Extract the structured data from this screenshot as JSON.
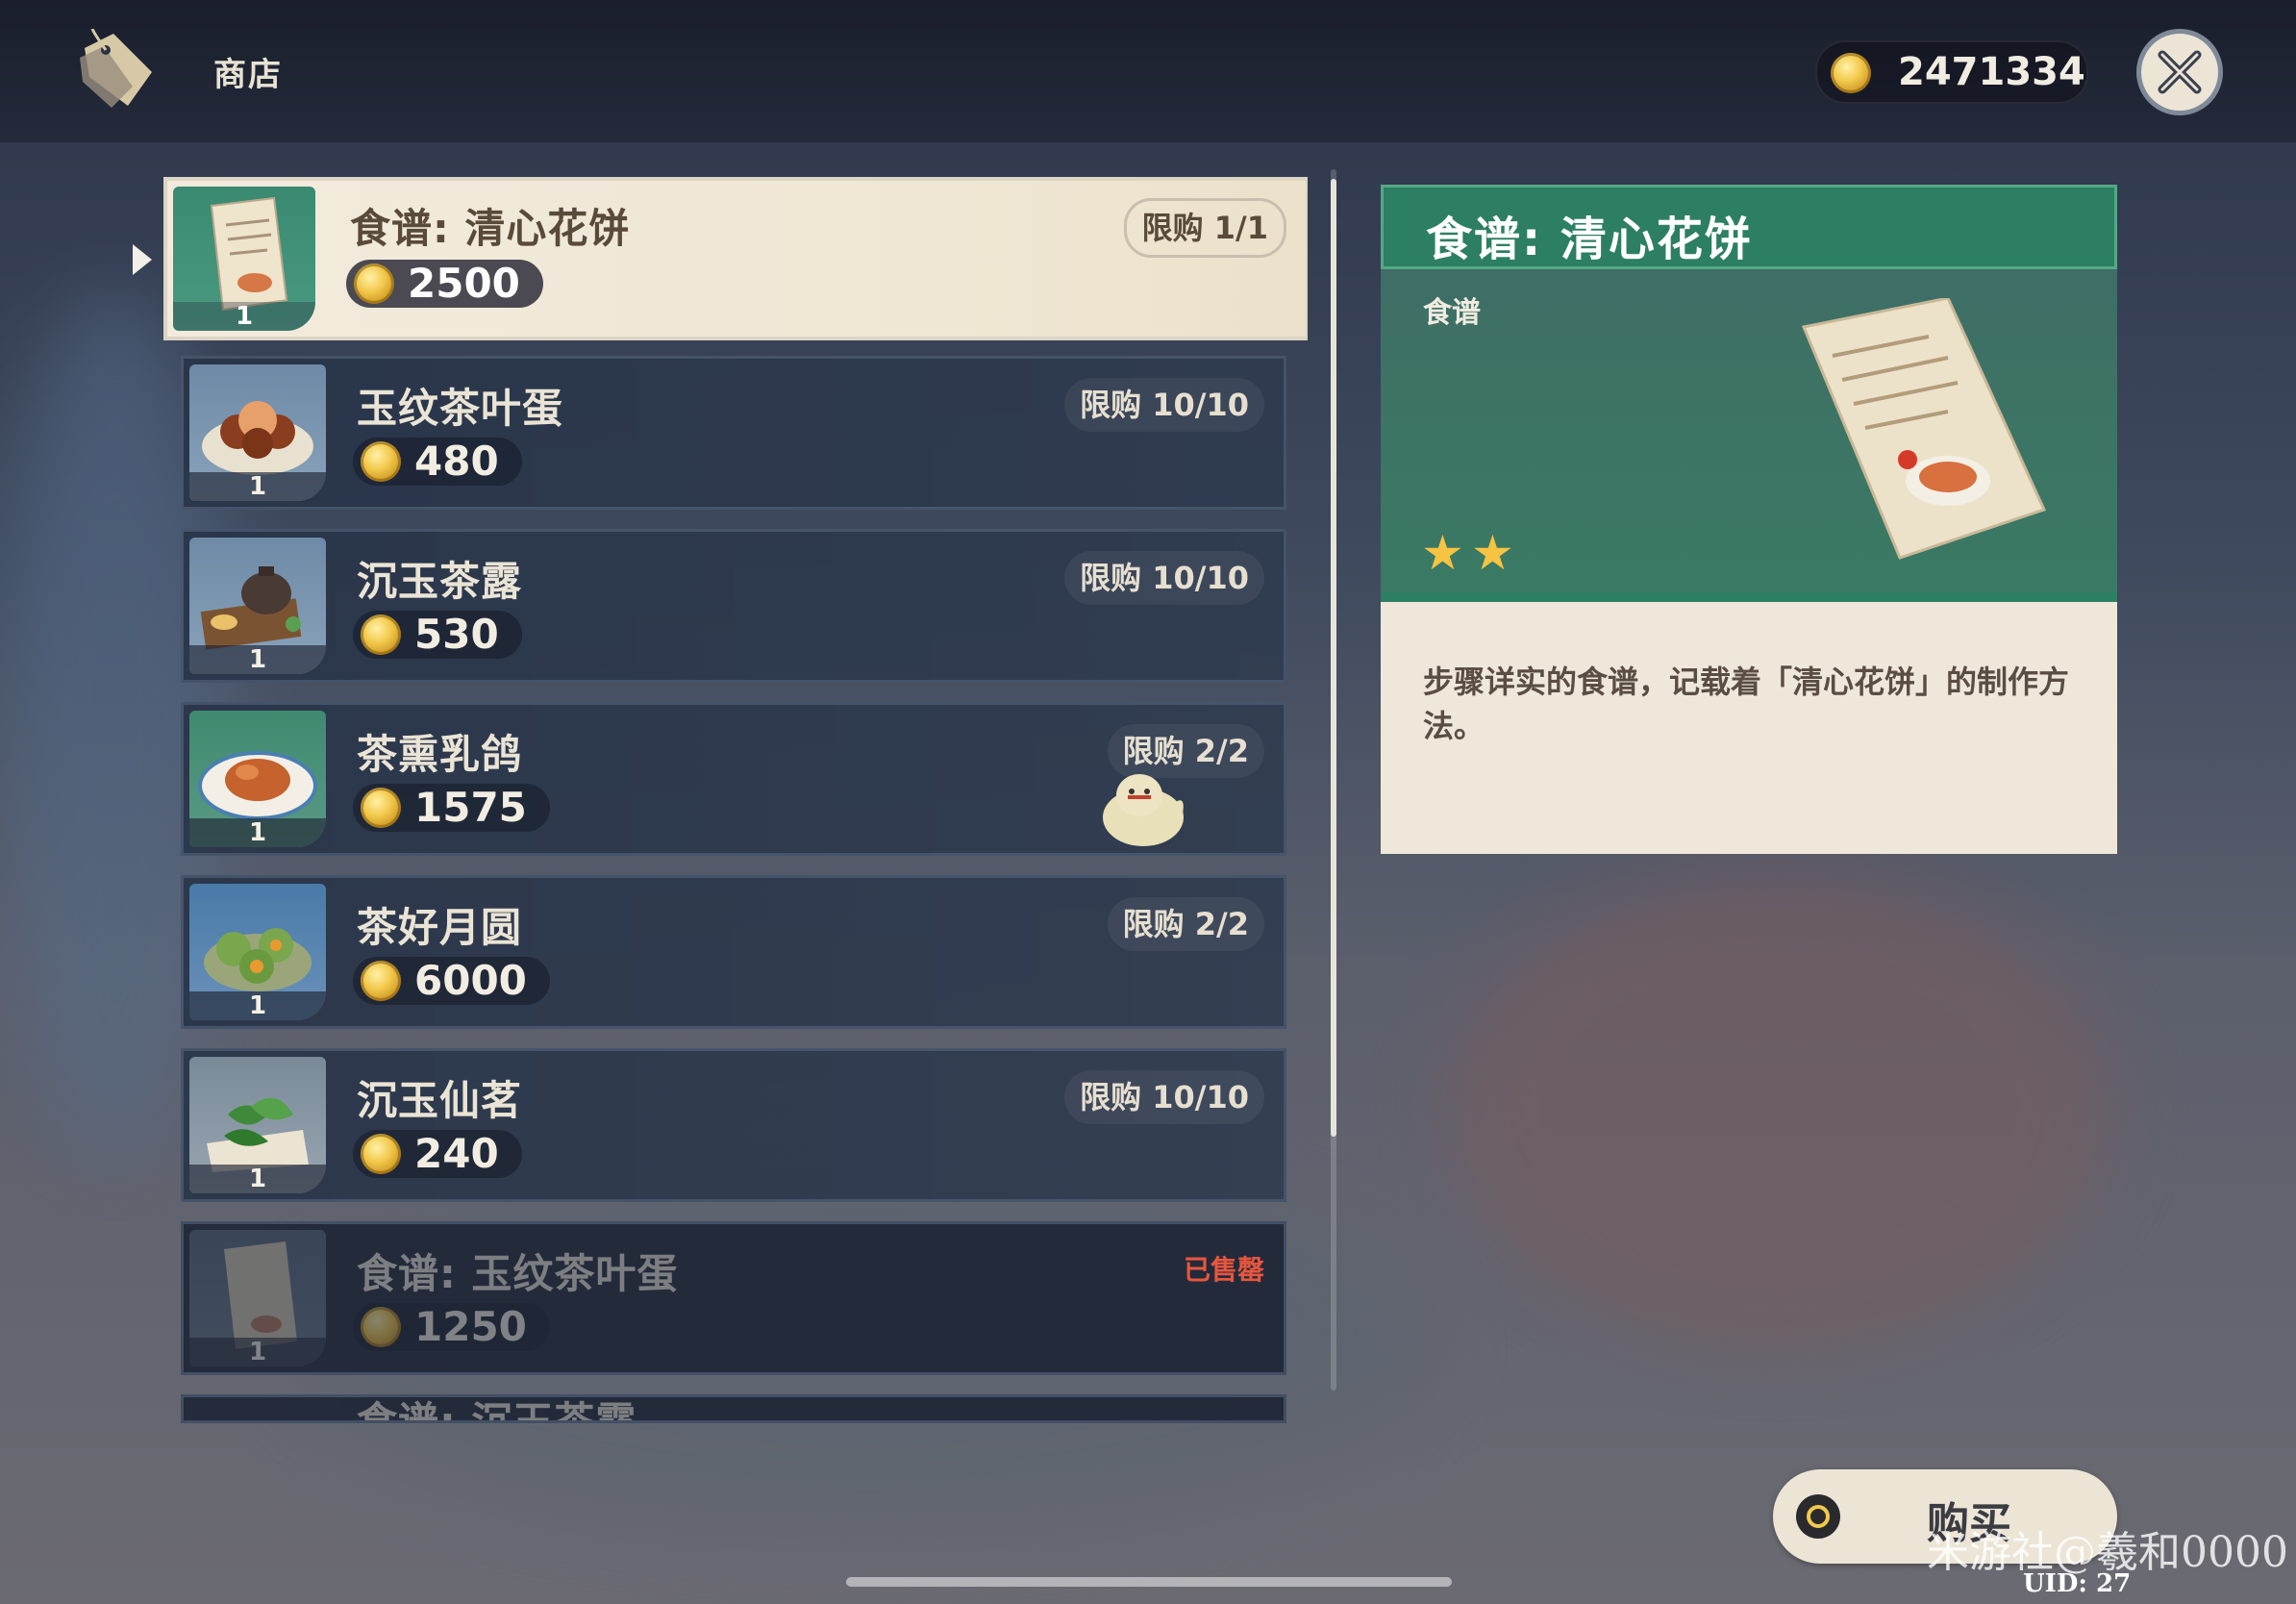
{
  "header": {
    "title": "商店",
    "currency": "2471334"
  },
  "items": [
    {
      "name": "食谱: 清心花饼",
      "price": "2500",
      "limit": "限购 1/1",
      "qty": "1"
    },
    {
      "name": "玉纹茶叶蛋",
      "price": "480",
      "limit": "限购 10/10",
      "qty": "1"
    },
    {
      "name": "沉玉茶露",
      "price": "530",
      "limit": "限购 10/10",
      "qty": "1"
    },
    {
      "name": "茶熏乳鸽",
      "price": "1575",
      "limit": "限购 2/2",
      "qty": "1"
    },
    {
      "name": "茶好月圆",
      "price": "6000",
      "limit": "限购 2/2",
      "qty": "1"
    },
    {
      "name": "沉玉仙茗",
      "price": "240",
      "limit": "限购 10/10",
      "qty": "1"
    },
    {
      "name": "食谱: 玉纹茶叶蛋",
      "price": "1250",
      "status": "已售罄",
      "qty": "1"
    },
    {
      "name": "食谱: 沉玉茶露"
    }
  ],
  "detail": {
    "title": "食谱: 清心花饼",
    "category": "食谱",
    "rarity": 2,
    "description": "步骤详实的食谱，记载着「清心花饼」的制作方法。"
  },
  "buy": {
    "label": "购买"
  },
  "watermark": "米游社@羲和0000",
  "uid": "UID: 27",
  "colors": {
    "accent_green": "#2d7f63",
    "coin_gold": "#f2c94c",
    "soldout_red": "#e8563e",
    "star_yellow": "#f6c343"
  }
}
